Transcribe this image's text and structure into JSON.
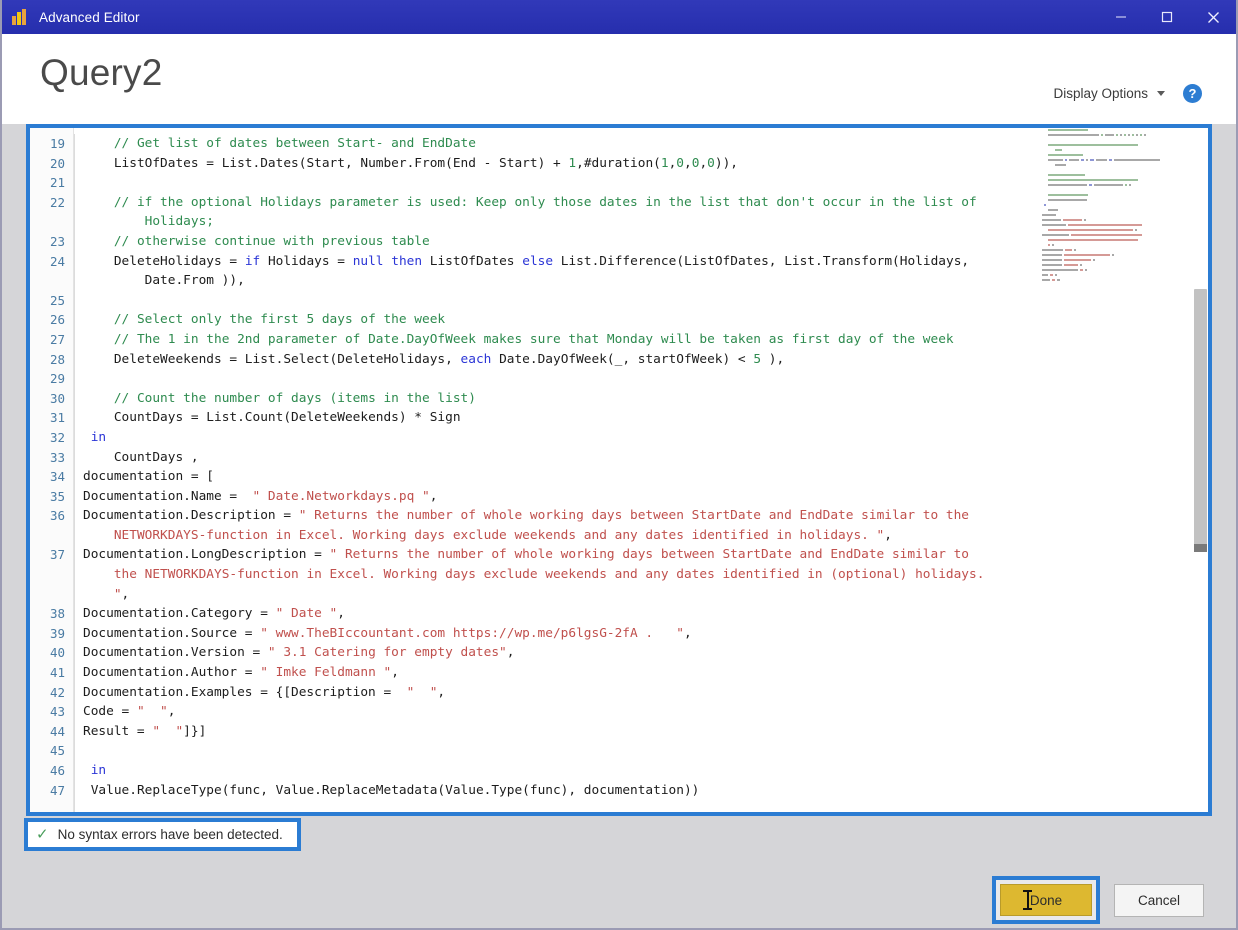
{
  "window": {
    "title": "Advanced Editor",
    "icon": "power-bi-icon",
    "controls": [
      {
        "name": "minimize",
        "glyph": "─"
      },
      {
        "name": "maximize",
        "glyph": "□"
      },
      {
        "name": "close",
        "glyph": "✕"
      }
    ]
  },
  "header": {
    "page_title": "Query2",
    "display_options_label": "Display Options",
    "help_label": "?"
  },
  "editor": {
    "first_line_number": 19,
    "lines": [
      {
        "num": "19",
        "indent": 4,
        "tokens": [
          {
            "t": "// Get list of dates between Start- and EndDate",
            "c": "cmt"
          }
        ]
      },
      {
        "num": "20",
        "indent": 4,
        "tokens": [
          {
            "t": "ListOfDates = List.Dates(Start, Number.From(End - Start) + ",
            "c": "op"
          },
          {
            "t": "1",
            "c": "num"
          },
          {
            "t": ",#duration(",
            "c": "op"
          },
          {
            "t": "1",
            "c": "num"
          },
          {
            "t": ",",
            "c": "op"
          },
          {
            "t": "0",
            "c": "num"
          },
          {
            "t": ",",
            "c": "op"
          },
          {
            "t": "0",
            "c": "num"
          },
          {
            "t": ",",
            "c": "op"
          },
          {
            "t": "0",
            "c": "num"
          },
          {
            "t": ")),",
            "c": "op"
          }
        ]
      },
      {
        "num": "21",
        "indent": 0,
        "tokens": []
      },
      {
        "num": "22",
        "indent": 4,
        "tokens": [
          {
            "t": "// if the optional Holidays parameter is used: Keep only those dates in the list that don't occur in the list of",
            "c": "cmt"
          }
        ]
      },
      {
        "num": "",
        "indent": 8,
        "tokens": [
          {
            "t": "Holidays;",
            "c": "cmt"
          }
        ]
      },
      {
        "num": "23",
        "indent": 4,
        "tokens": [
          {
            "t": "// otherwise continue with previous table",
            "c": "cmt"
          }
        ]
      },
      {
        "num": "24",
        "indent": 4,
        "tokens": [
          {
            "t": "DeleteHolidays = ",
            "c": "op"
          },
          {
            "t": "if",
            "c": "kw"
          },
          {
            "t": " Holidays = ",
            "c": "op"
          },
          {
            "t": "null",
            "c": "kw"
          },
          {
            "t": " ",
            "c": "op"
          },
          {
            "t": "then",
            "c": "kw"
          },
          {
            "t": " ListOfDates ",
            "c": "op"
          },
          {
            "t": "else",
            "c": "kw"
          },
          {
            "t": " List.Difference(ListOfDates, List.Transform(Holidays,",
            "c": "op"
          }
        ]
      },
      {
        "num": "",
        "indent": 8,
        "tokens": [
          {
            "t": "Date.From )),",
            "c": "op"
          }
        ]
      },
      {
        "num": "25",
        "indent": 0,
        "tokens": []
      },
      {
        "num": "26",
        "indent": 4,
        "tokens": [
          {
            "t": "// Select only the first 5 days of the week",
            "c": "cmt"
          }
        ]
      },
      {
        "num": "27",
        "indent": 4,
        "tokens": [
          {
            "t": "// The 1 in the 2nd parameter of Date.DayOfWeek makes sure that Monday will be taken as first day of the week",
            "c": "cmt"
          }
        ]
      },
      {
        "num": "28",
        "indent": 4,
        "tokens": [
          {
            "t": "DeleteWeekends = List.Select(DeleteHolidays, ",
            "c": "op"
          },
          {
            "t": "each",
            "c": "kw"
          },
          {
            "t": " Date.DayOfWeek(_, startOfWeek) < ",
            "c": "op"
          },
          {
            "t": "5",
            "c": "num"
          },
          {
            "t": " ),",
            "c": "op"
          }
        ]
      },
      {
        "num": "29",
        "indent": 0,
        "tokens": []
      },
      {
        "num": "30",
        "indent": 4,
        "tokens": [
          {
            "t": "// Count the number of days (items in the list)",
            "c": "cmt"
          }
        ]
      },
      {
        "num": "31",
        "indent": 4,
        "tokens": [
          {
            "t": "CountDays = List.Count(DeleteWeekends) * Sign",
            "c": "op"
          }
        ]
      },
      {
        "num": "32",
        "indent": 1,
        "tokens": [
          {
            "t": "in",
            "c": "kw"
          }
        ]
      },
      {
        "num": "33",
        "indent": 4,
        "tokens": [
          {
            "t": "CountDays ,",
            "c": "op"
          }
        ]
      },
      {
        "num": "34",
        "indent": 0,
        "tokens": [
          {
            "t": "documentation = [",
            "c": "op"
          }
        ]
      },
      {
        "num": "35",
        "indent": 0,
        "tokens": [
          {
            "t": "Documentation.Name =  ",
            "c": "op"
          },
          {
            "t": "\" Date.Networkdays.pq \"",
            "c": "str"
          },
          {
            "t": ",",
            "c": "op"
          }
        ]
      },
      {
        "num": "36",
        "indent": 0,
        "tokens": [
          {
            "t": "Documentation.Description = ",
            "c": "op"
          },
          {
            "t": "\" Returns the number of whole working days between StartDate and EndDate similar to the",
            "c": "str"
          }
        ]
      },
      {
        "num": "",
        "indent": 4,
        "tokens": [
          {
            "t": "NETWORKDAYS-function in Excel. Working days exclude weekends and any dates identified in holidays. \"",
            "c": "str"
          },
          {
            "t": ",",
            "c": "op"
          }
        ]
      },
      {
        "num": "37",
        "indent": 0,
        "tokens": [
          {
            "t": "Documentation.LongDescription = ",
            "c": "op"
          },
          {
            "t": "\" Returns the number of whole working days between StartDate and EndDate similar to",
            "c": "str"
          }
        ]
      },
      {
        "num": "",
        "indent": 4,
        "tokens": [
          {
            "t": "the NETWORKDAYS-function in Excel. Working days exclude weekends and any dates identified in (optional) holidays.",
            "c": "str"
          }
        ]
      },
      {
        "num": "",
        "indent": 4,
        "tokens": [
          {
            "t": "\"",
            "c": "str"
          },
          {
            "t": ",",
            "c": "op"
          }
        ]
      },
      {
        "num": "38",
        "indent": 0,
        "tokens": [
          {
            "t": "Documentation.Category = ",
            "c": "op"
          },
          {
            "t": "\" Date \"",
            "c": "str"
          },
          {
            "t": ",",
            "c": "op"
          }
        ]
      },
      {
        "num": "39",
        "indent": 0,
        "tokens": [
          {
            "t": "Documentation.Source = ",
            "c": "op"
          },
          {
            "t": "\" www.TheBIccountant.com https://wp.me/p6lgsG-2fA .   \"",
            "c": "str"
          },
          {
            "t": ",",
            "c": "op"
          }
        ]
      },
      {
        "num": "40",
        "indent": 0,
        "tokens": [
          {
            "t": "Documentation.Version = ",
            "c": "op"
          },
          {
            "t": "\" 3.1 Catering for empty dates\"",
            "c": "str"
          },
          {
            "t": ",",
            "c": "op"
          }
        ]
      },
      {
        "num": "41",
        "indent": 0,
        "tokens": [
          {
            "t": "Documentation.Author = ",
            "c": "op"
          },
          {
            "t": "\" Imke Feldmann \"",
            "c": "str"
          },
          {
            "t": ",",
            "c": "op"
          }
        ]
      },
      {
        "num": "42",
        "indent": 0,
        "tokens": [
          {
            "t": "Documentation.Examples = {[Description =  ",
            "c": "op"
          },
          {
            "t": "\"  \"",
            "c": "str"
          },
          {
            "t": ",",
            "c": "op"
          }
        ]
      },
      {
        "num": "43",
        "indent": 0,
        "tokens": [
          {
            "t": "Code = ",
            "c": "op"
          },
          {
            "t": "\"  \"",
            "c": "str"
          },
          {
            "t": ",",
            "c": "op"
          }
        ]
      },
      {
        "num": "44",
        "indent": 0,
        "tokens": [
          {
            "t": "Result = ",
            "c": "op"
          },
          {
            "t": "\"  \"",
            "c": "str"
          },
          {
            "t": "]}]",
            "c": "op"
          }
        ]
      },
      {
        "num": "45",
        "indent": 0,
        "tokens": []
      },
      {
        "num": "46",
        "indent": 1,
        "tokens": [
          {
            "t": "in",
            "c": "kw"
          }
        ]
      },
      {
        "num": "47",
        "indent": 1,
        "tokens": [
          {
            "t": "Value.ReplaceType(func, Value.ReplaceMetadata(Value.Type(func), documentation))",
            "c": "op"
          }
        ]
      }
    ]
  },
  "status": {
    "icon": "check-icon",
    "text": "No syntax errors have been detected."
  },
  "footer": {
    "done_label": "Done",
    "cancel_label": "Cancel"
  },
  "colors": {
    "titlebar": "#2b32b2",
    "highlight_border": "#2b7cd3",
    "done_button": "#ddb830",
    "comment": "#2e8b4f",
    "keyword": "#2b35d6",
    "string": "#c0504d",
    "line_number": "#4a7ba3"
  }
}
